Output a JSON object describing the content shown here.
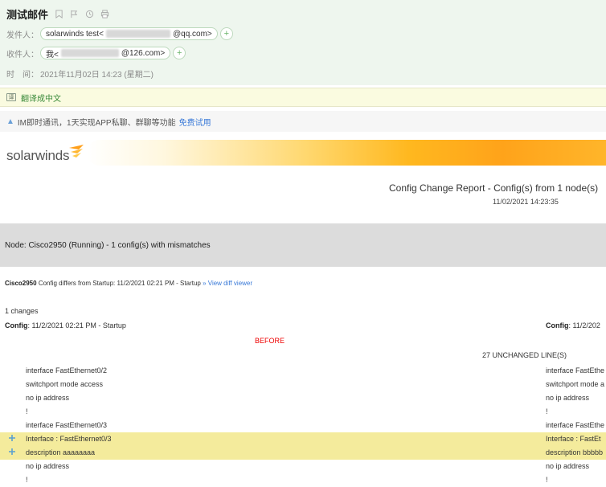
{
  "mail": {
    "subject": "测试邮件",
    "from_label": "发件人：",
    "from_name": "solarwinds test<",
    "from_domain": "@qq.com>",
    "to_label": "收件人：",
    "to_name": "我<",
    "to_domain": "@126.com>",
    "time_label": "时　间：",
    "time_value": "2021年11月02日 14:23 (星期二)",
    "plus": "+"
  },
  "translate": {
    "label": "翻译成中文",
    "icon": "译"
  },
  "im_bar": {
    "text": "IM即时通讯，1天实现APP私聊、群聊等功能",
    "link": "免费试用"
  },
  "brand": {
    "logo": "solarwinds"
  },
  "report": {
    "title": "Config Change Report - Config(s) from 1 node(s)",
    "date": "11/02/2021 14:23:35",
    "node": "Node: Cisco2950 (Running) - 1 config(s) with mismatches",
    "differs_device": "Cisco2950",
    "differs_text": " Config differs from Startup: 11/2/2021 02:21 PM - Startup ",
    "differs_link": "» View diff viewer",
    "changes": "1 changes",
    "config_label": "Config",
    "config_left": ": 11/2/2021 02:21 PM - Startup",
    "config_right": ": 11/2/202",
    "before": "BEFORE",
    "unchanged": "27 UNCHANGED LINE(S)",
    "lines": [
      {
        "left": "interface FastEthernet0/2",
        "right": "interface FastEthe",
        "highlight": false
      },
      {
        "left": "switchport mode access",
        "right": "switchport mode a",
        "highlight": false
      },
      {
        "left": "no ip address",
        "right": "no ip address",
        "highlight": false
      },
      {
        "left": "!",
        "right": "!",
        "highlight": false
      },
      {
        "left": "interface FastEthernet0/3",
        "right": "interface FastEthe",
        "highlight": false
      },
      {
        "left": "Interface : FastEthernet0/3",
        "right": "Interface : FastEt",
        "highlight": true
      },
      {
        "left": "description aaaaaaaa",
        "right": "description bbbbb",
        "highlight": true
      },
      {
        "left": "no ip address",
        "right": "no ip address",
        "highlight": false
      },
      {
        "left": "!",
        "right": "!",
        "highlight": false
      }
    ]
  },
  "colors": {
    "header_bg": "#eef6ee",
    "highlight": "#f4eb9c",
    "before_red": "#e00000",
    "link_blue": "#3a7ad8",
    "brand_orange": "#ffa31a"
  }
}
